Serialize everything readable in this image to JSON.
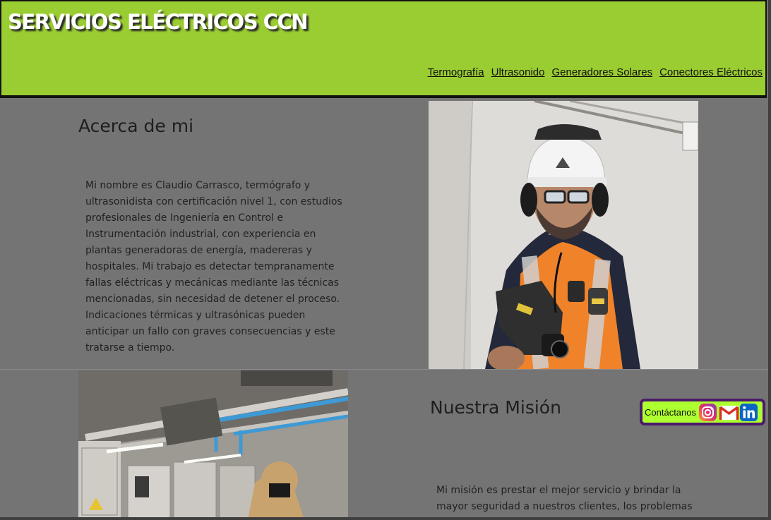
{
  "header": {
    "site_title": "SERVICIOS ELÉCTRICOS CCN",
    "nav": [
      {
        "label": "Termografía"
      },
      {
        "label": "Ultrasonido"
      },
      {
        "label": "Generadores Solares"
      },
      {
        "label": "Conectores Eléctricos"
      }
    ],
    "background_color": "#9acd32"
  },
  "about": {
    "heading": "Acerca de mi",
    "text": "Mi nombre es Claudio Carrasco, termógrafo y ultrasonidista con certificación nivel 1, con estudios profesionales de Ingeniería en Control e Instrumentación industrial, con experiencia en plantas generadoras de energía, madereras y hospitales. Mi trabajo es detectar tempranamente fallas eléctricas y mecánicas mediante las técnicas mencionadas, sin necesidad de detener el proceso. Indicaciones térmicas y ultrasónicas pueden anticipar un fallo con graves consecuencias y este tratarse a tiempo."
  },
  "mission": {
    "heading": "Nuestra Misión",
    "text": "Mi misión es prestar el mejor servicio y brindar la mayor seguridad a nuestros clientes, los problemas"
  },
  "contact": {
    "label": "Contáctanos",
    "icons": [
      "instagram-icon",
      "gmail-icon",
      "linkedin-icon"
    ],
    "background_color": "#adff2f",
    "border_color": "#4b1a6b"
  }
}
